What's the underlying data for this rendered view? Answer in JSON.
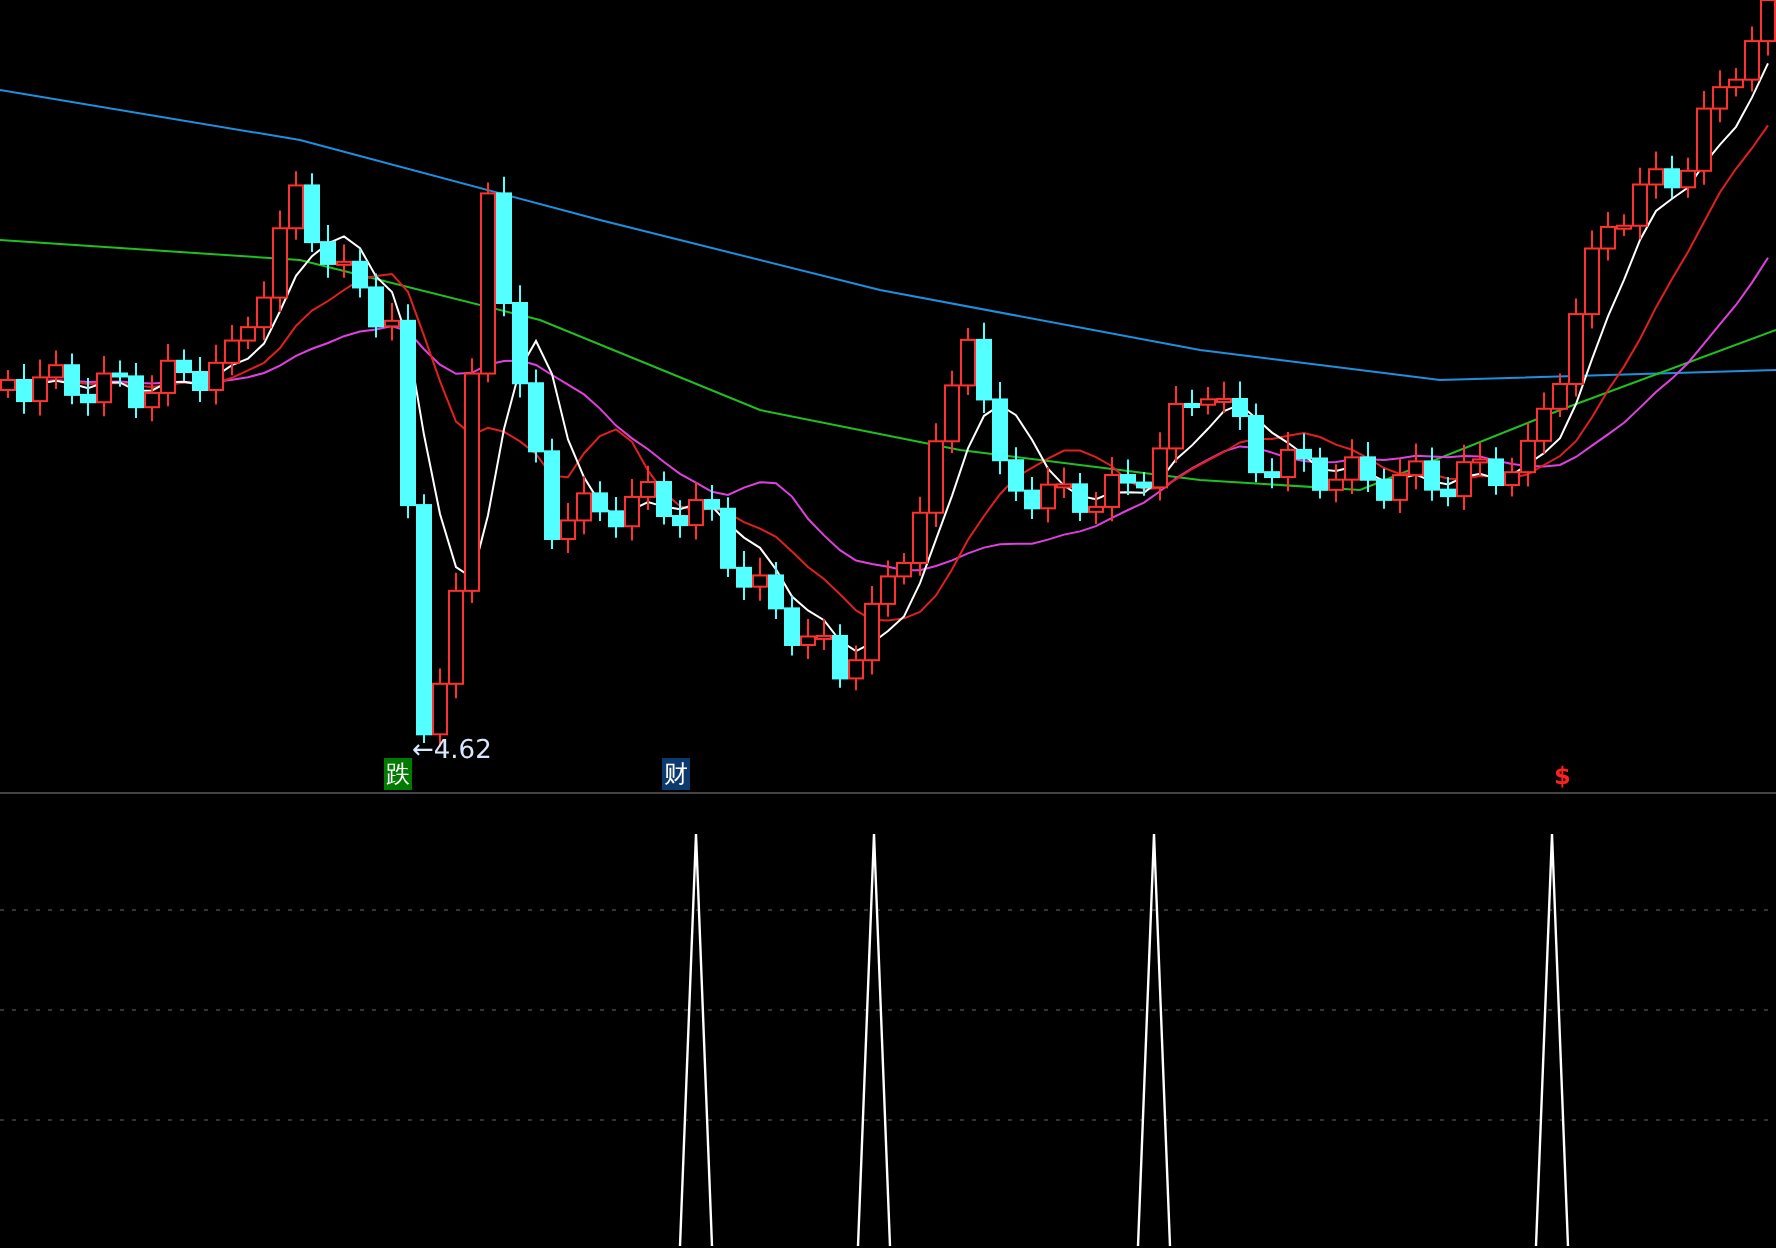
{
  "main_chart": {
    "low_label": "←4.62",
    "markers": [
      {
        "text": "跌",
        "color": "#007a00",
        "kind": "tag"
      },
      {
        "text": "财",
        "color": "#0d3a6e",
        "kind": "tag"
      },
      {
        "text": "$",
        "color": "#ff2020",
        "kind": "glyph"
      }
    ]
  }
}
